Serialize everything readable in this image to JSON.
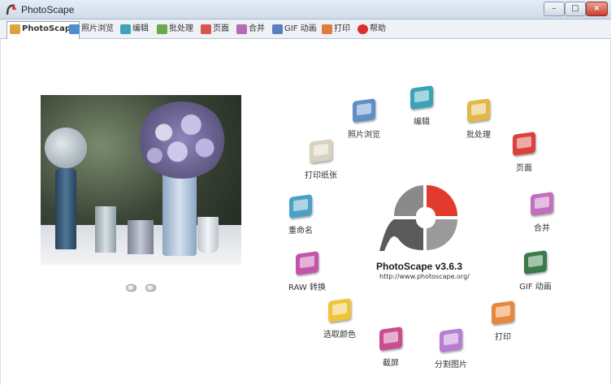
{
  "window": {
    "title": "PhotoScape",
    "controls": {
      "minimize": "–",
      "maximize": "□",
      "close": "×"
    }
  },
  "tabs": [
    {
      "label": "PhotoScape",
      "icon": "photoscape-icon",
      "color": "#e0a23a"
    },
    {
      "label": "照片浏览",
      "icon": "photo-viewer-icon",
      "color": "#4a8fd0"
    },
    {
      "label": "编辑",
      "icon": "editor-icon",
      "color": "#3da4b8"
    },
    {
      "label": "批处理",
      "icon": "batch-icon",
      "color": "#6aa84f"
    },
    {
      "label": "页面",
      "icon": "page-icon",
      "color": "#d9534f"
    },
    {
      "label": "合并",
      "icon": "combine-icon",
      "color": "#b76ab8"
    },
    {
      "label": "GIF 动画",
      "icon": "gif-icon",
      "color": "#5b7fbf"
    },
    {
      "label": "打印",
      "icon": "print-icon",
      "color": "#e07b39"
    },
    {
      "label": "帮助",
      "icon": "help-icon",
      "color": "#d9302c"
    }
  ],
  "logo": {
    "title": "PhotoScape v3.6.3",
    "url": "http://www.photoscape.org/",
    "colors": {
      "red": "#e23a2c",
      "gray": "#8c8c8c",
      "dark": "#555555"
    }
  },
  "menu": [
    {
      "label": "照片浏览",
      "icon": "photo-viewer-icon",
      "color": "#5e8fc6"
    },
    {
      "label": "编辑",
      "icon": "editor-icon",
      "color": "#3aa3b7"
    },
    {
      "label": "批处理",
      "icon": "batch-icon",
      "color": "#e2b84a"
    },
    {
      "label": "页面",
      "icon": "page-icon",
      "color": "#d9433b"
    },
    {
      "label": "合并",
      "icon": "combine-icon",
      "color": "#c26fbd"
    },
    {
      "label": "GIF 动画",
      "icon": "gif-icon",
      "color": "#3b7b4a"
    },
    {
      "label": "打印",
      "icon": "print-icon",
      "color": "#e8883a"
    },
    {
      "label": "分割图片",
      "icon": "splitter-icon",
      "color": "#b77fcf"
    },
    {
      "label": "截屏",
      "icon": "screen-capture-icon",
      "color": "#c74f8f"
    },
    {
      "label": "选取颜色",
      "icon": "color-picker-icon",
      "color": "#f0c43a"
    },
    {
      "label": "RAW 转换",
      "icon": "raw-converter-icon",
      "color": "#c354a8"
    },
    {
      "label": "重命名",
      "icon": "rename-icon",
      "color": "#4aa0c8"
    },
    {
      "label": "打印纸张",
      "icon": "paper-print-icon",
      "color": "#d8d2bf"
    }
  ]
}
